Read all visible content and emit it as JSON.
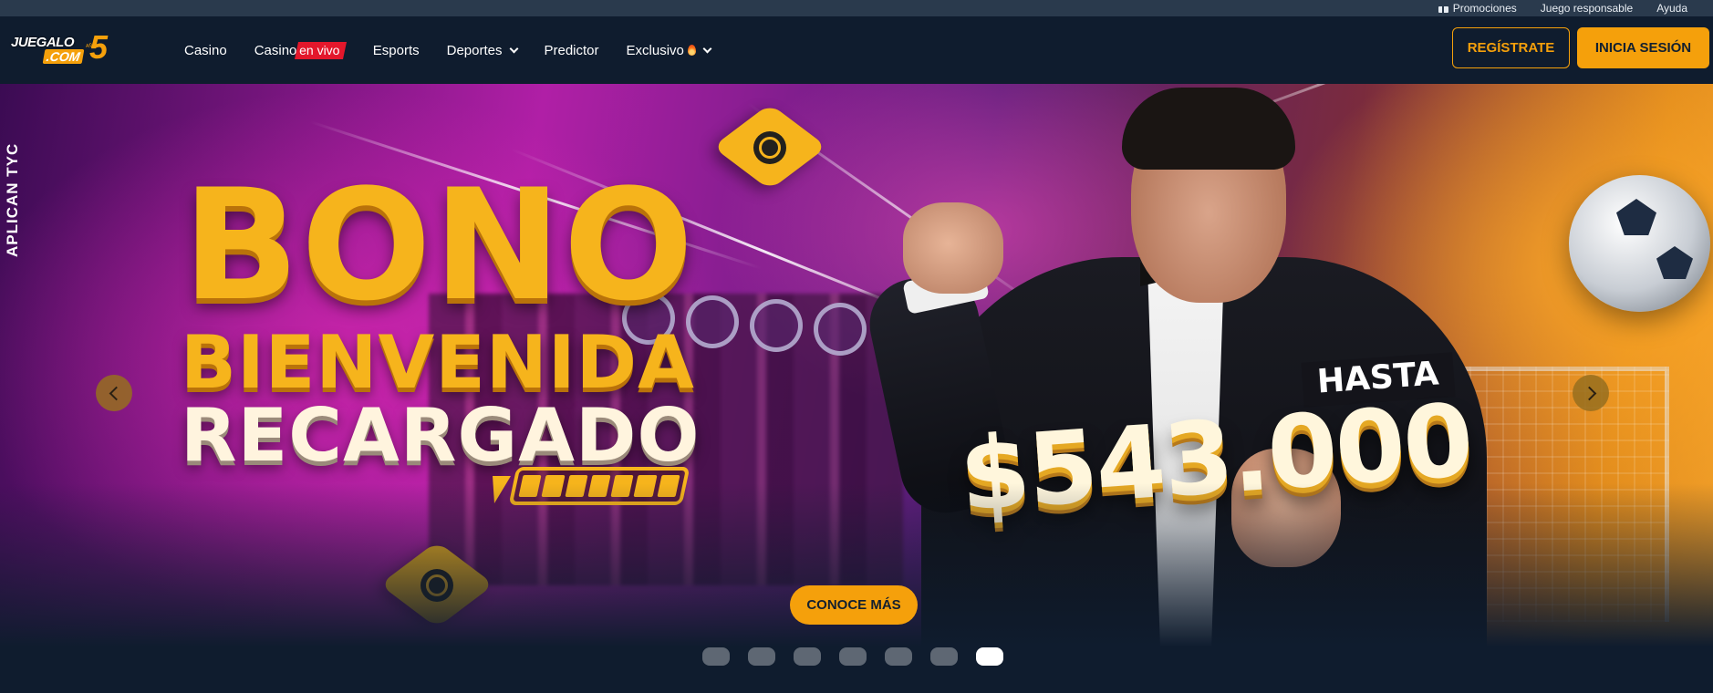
{
  "utility_bar": {
    "promotions": "Promociones",
    "responsible": "Juego responsable",
    "help": "Ayuda"
  },
  "logo": {
    "line1": "JUEGALO",
    "line2": ".COM",
    "number": "5",
    "anos": "AÑOS"
  },
  "nav": {
    "casino": "Casino",
    "casino_live_prefix": "Casino",
    "casino_live_badge": "en vivo",
    "esports": "Esports",
    "deportes": "Deportes",
    "predictor": "Predictor",
    "exclusivo": "Exclusivo"
  },
  "auth": {
    "register": "REGÍSTRATE",
    "login": "INICIA SESIÓN"
  },
  "hero": {
    "tyc": "APLICAN TYC",
    "line1": "BONO",
    "line2": "BIENVENIDA",
    "line3": "RECARGADO",
    "hasta": "HASTA",
    "amount": "$543.000",
    "cta": "CONOCE MÁS",
    "slide_count": 7,
    "active_slide": 7
  },
  "colors": {
    "accent": "#f5a00b",
    "nav_bg": "#0f1c2e",
    "util_bg": "#2a3a4d",
    "live_red": "#e3172b"
  }
}
